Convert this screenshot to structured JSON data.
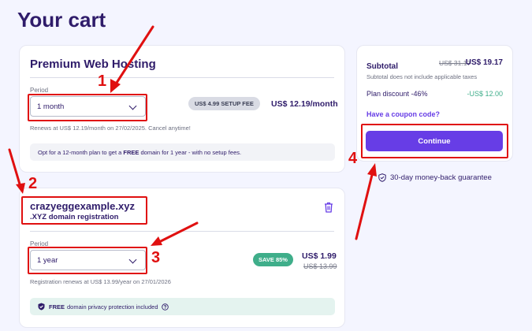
{
  "page": {
    "title": "Your cart"
  },
  "hosting": {
    "title": "Premium Web Hosting",
    "period_label": "Period",
    "period_value": "1 month",
    "setup_fee": "US$ 4.99 SETUP FEE",
    "price": "US$ 12.19/month",
    "renew_note": "Renews at US$ 12.19/month on 27/02/2025. Cancel anytime!",
    "promo_prefix": "Opt for a 12-month plan to get a ",
    "promo_bold": "FREE",
    "promo_suffix": " domain for 1 year - with no setup fees."
  },
  "domain": {
    "name": "crazyeggexample.xyz",
    "subtitle": ".XYZ domain registration",
    "period_label": "Period",
    "period_value": "1 year",
    "save_badge": "SAVE 85%",
    "price": "US$ 1.99",
    "old_price": "US$ 13.99",
    "renew_note": "Registration renews at US$ 13.99/year on 27/01/2026",
    "privacy_bold": "FREE",
    "privacy_text": "domain privacy protection included"
  },
  "summary": {
    "subtotal_label": "Subtotal",
    "subtotal_old": "US$ 31.17",
    "subtotal_new": "US$ 19.17",
    "tax_note": "Subtotal does not include applicable taxes",
    "discount_label": "Plan discount -46%",
    "discount_value": "-US$ 12.00",
    "coupon_link": "Have a coupon code?",
    "continue_label": "Continue",
    "guarantee": "30-day money-back guarantee"
  },
  "annotations": {
    "n1": "1",
    "n2": "2",
    "n3": "3",
    "n4": "4"
  },
  "colors": {
    "primary": "#673de6",
    "heading": "#2f1c6a",
    "success": "#3fae8a",
    "annotation": "#e01010"
  },
  "icons": [
    "chevron-down-icon",
    "trash-icon",
    "shield-check-icon",
    "info-icon"
  ]
}
